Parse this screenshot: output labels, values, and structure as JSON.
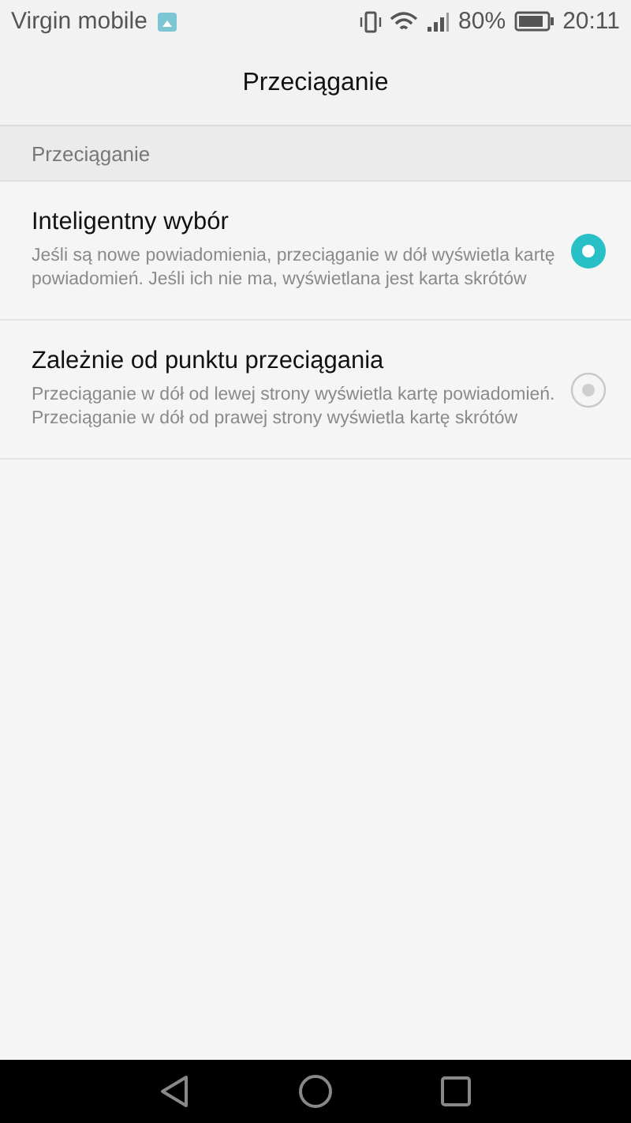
{
  "status_bar": {
    "carrier": "Virgin mobile",
    "battery": "80%",
    "time": "20:11"
  },
  "header": {
    "title": "Przeciąganie"
  },
  "section": {
    "title": "Przeciąganie"
  },
  "options": [
    {
      "title": "Inteligentny wybór",
      "description": "Jeśli są nowe powiadomienia, przeciąganie w dół wyświetla kartę powiadomień. Jeśli ich nie ma, wyświetlana jest karta skrótów",
      "selected": true
    },
    {
      "title": "Zależnie od punktu przeciągania",
      "description": "Przeciąganie w dół od lewej strony wyświetla kartę powiadomień. Przeciąganie w dół od prawej strony wyświetla kartę skrótów",
      "selected": false
    }
  ]
}
